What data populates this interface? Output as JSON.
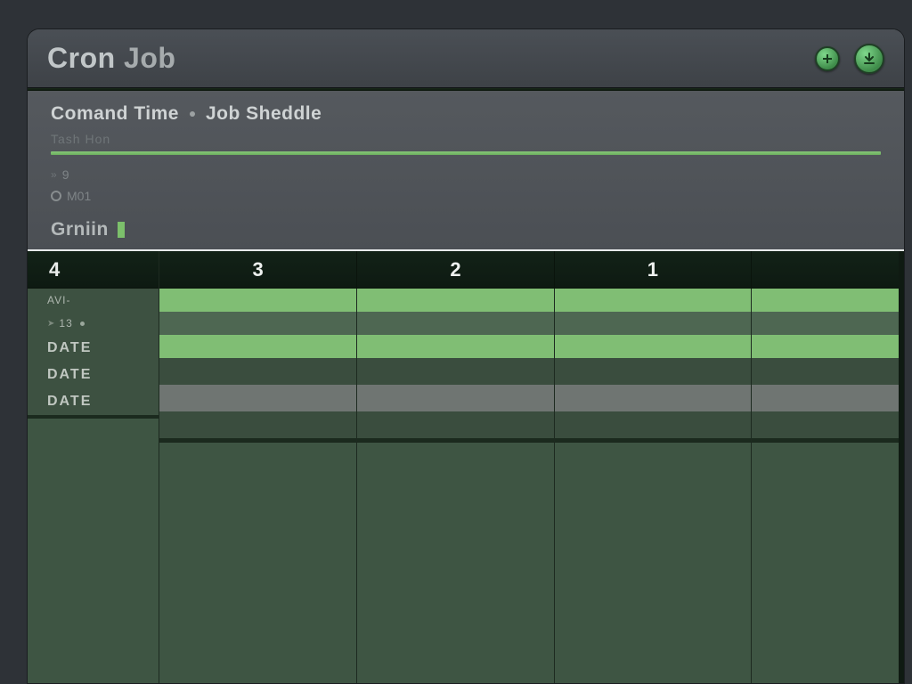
{
  "window": {
    "title_main": "Cron",
    "title_sub": "Job"
  },
  "header": {
    "breadcrumb_a": "Comand Time",
    "breadcrumb_b": "Job Sheddle",
    "sub_label": "Tash Hon",
    "meta1_prefix": "»",
    "meta1_value": "9",
    "meta2_label": "M01",
    "section_label": "Grniin"
  },
  "grid": {
    "corner_label": "4",
    "columns": [
      "3",
      "2",
      "1"
    ],
    "row_labels": {
      "r1": "AVI-",
      "r2_icon": "➤",
      "r2_text": "13",
      "r3": "DATE",
      "r4": "DATE",
      "r5": "DATE"
    }
  },
  "colors": {
    "accent_green": "#7cc06b",
    "bg_dark": "#2e3237"
  }
}
